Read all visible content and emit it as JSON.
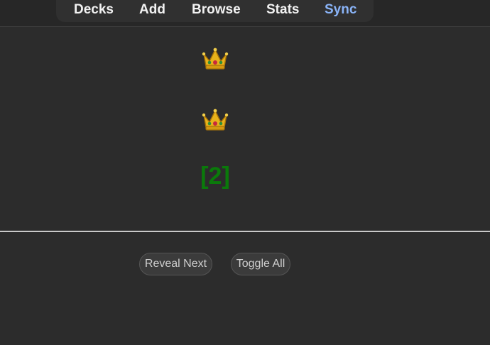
{
  "nav": {
    "items": [
      {
        "label": "Decks",
        "active": false
      },
      {
        "label": "Add",
        "active": false
      },
      {
        "label": "Browse",
        "active": false
      },
      {
        "label": "Stats",
        "active": false
      },
      {
        "label": "Sync",
        "active": true
      }
    ],
    "active_color": "#8ab4f8"
  },
  "card": {
    "crowns": [
      "crown-icon",
      "crown-icon"
    ],
    "cloze_text": "[2]",
    "cloze_color": "#0a7a0a"
  },
  "buttons": {
    "reveal_next": "Reveal Next",
    "toggle_all": "Toggle All"
  }
}
